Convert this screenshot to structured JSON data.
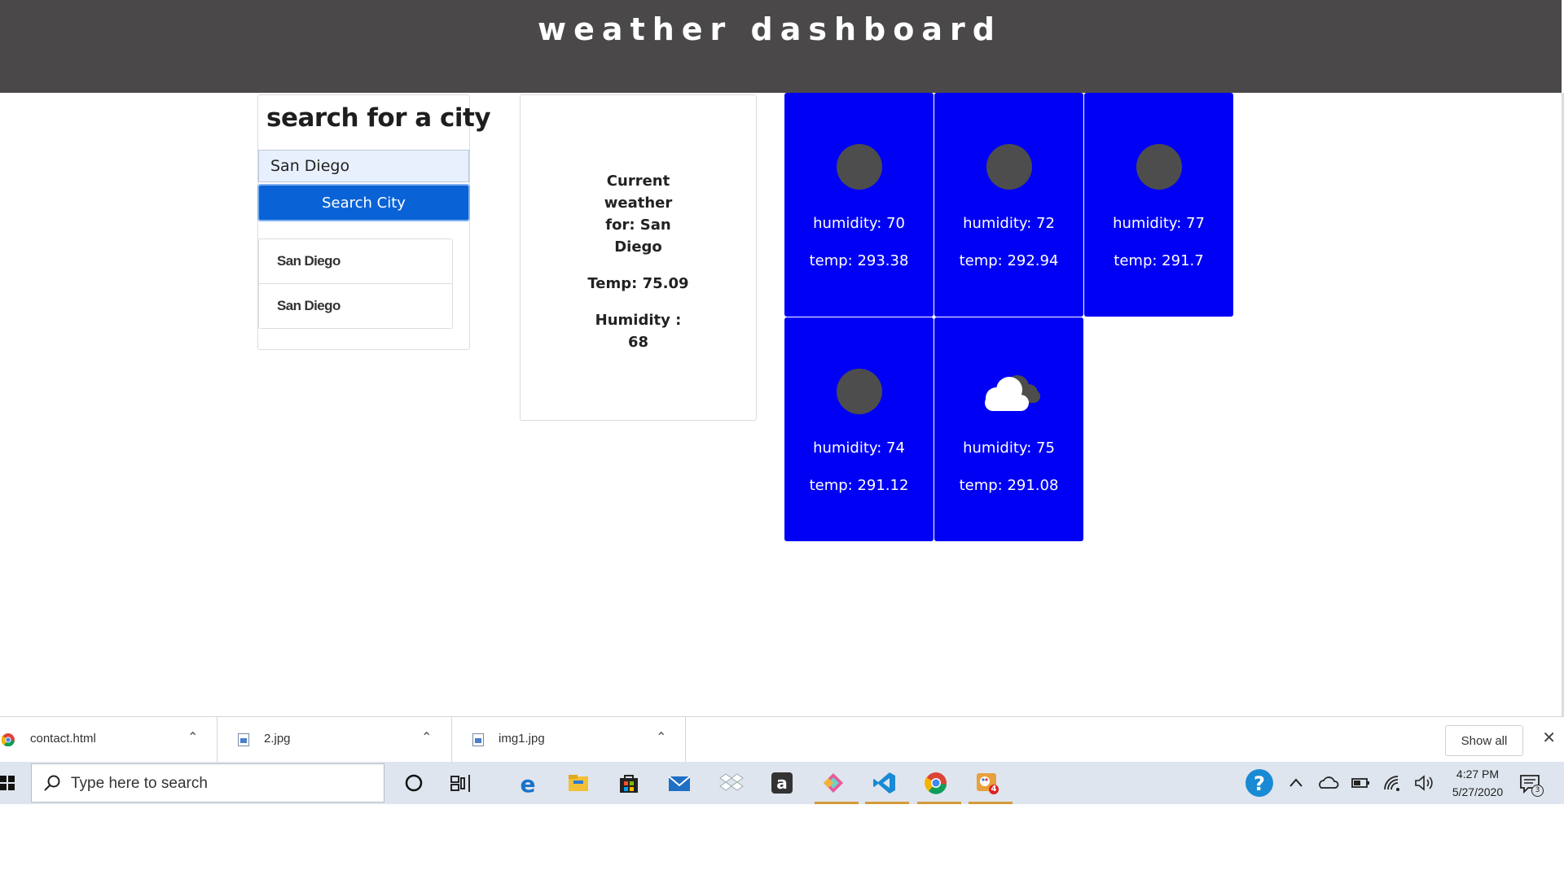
{
  "header": {
    "title": "weather dashboard"
  },
  "search": {
    "title": "search for a city",
    "input_value": "San Diego",
    "button_label": "Search City",
    "history": [
      "San Diego",
      "San Diego"
    ]
  },
  "current": {
    "heading": "Current weather for: San Diego",
    "temp": "Temp: 75.09",
    "humidity": "Humidity : 68"
  },
  "forecast": [
    {
      "icon": "dark-circle-icon",
      "humidity": "humidity: 70",
      "temp": "temp: 293.38"
    },
    {
      "icon": "dark-circle-icon",
      "humidity": "humidity: 72",
      "temp": "temp: 292.94"
    },
    {
      "icon": "dark-circle-icon",
      "humidity": "humidity: 77",
      "temp": "temp: 291.7"
    },
    {
      "icon": "dark-circle-icon",
      "humidity": "humidity: 74",
      "temp": "temp: 291.12"
    },
    {
      "icon": "cloud-icon",
      "humidity": "humidity: 75",
      "temp": "temp: 291.08"
    }
  ],
  "downloads": {
    "items": [
      {
        "name": "contact.html",
        "icon": "chrome-file-icon"
      },
      {
        "name": "2.jpg",
        "icon": "image-file-icon"
      },
      {
        "name": "img1.jpg",
        "icon": "image-file-icon"
      }
    ],
    "show_all": "Show all"
  },
  "taskbar": {
    "search_placeholder": "Type here to search",
    "time": "4:27 PM",
    "date": "5/27/2020",
    "notification_count": "3",
    "badge_count": "4"
  },
  "colors": {
    "header_bg": "#4a4848",
    "forecast_bg": "#0000f5",
    "button_bg": "#0a63d6",
    "taskbar_bg": "#dfe5ee"
  }
}
